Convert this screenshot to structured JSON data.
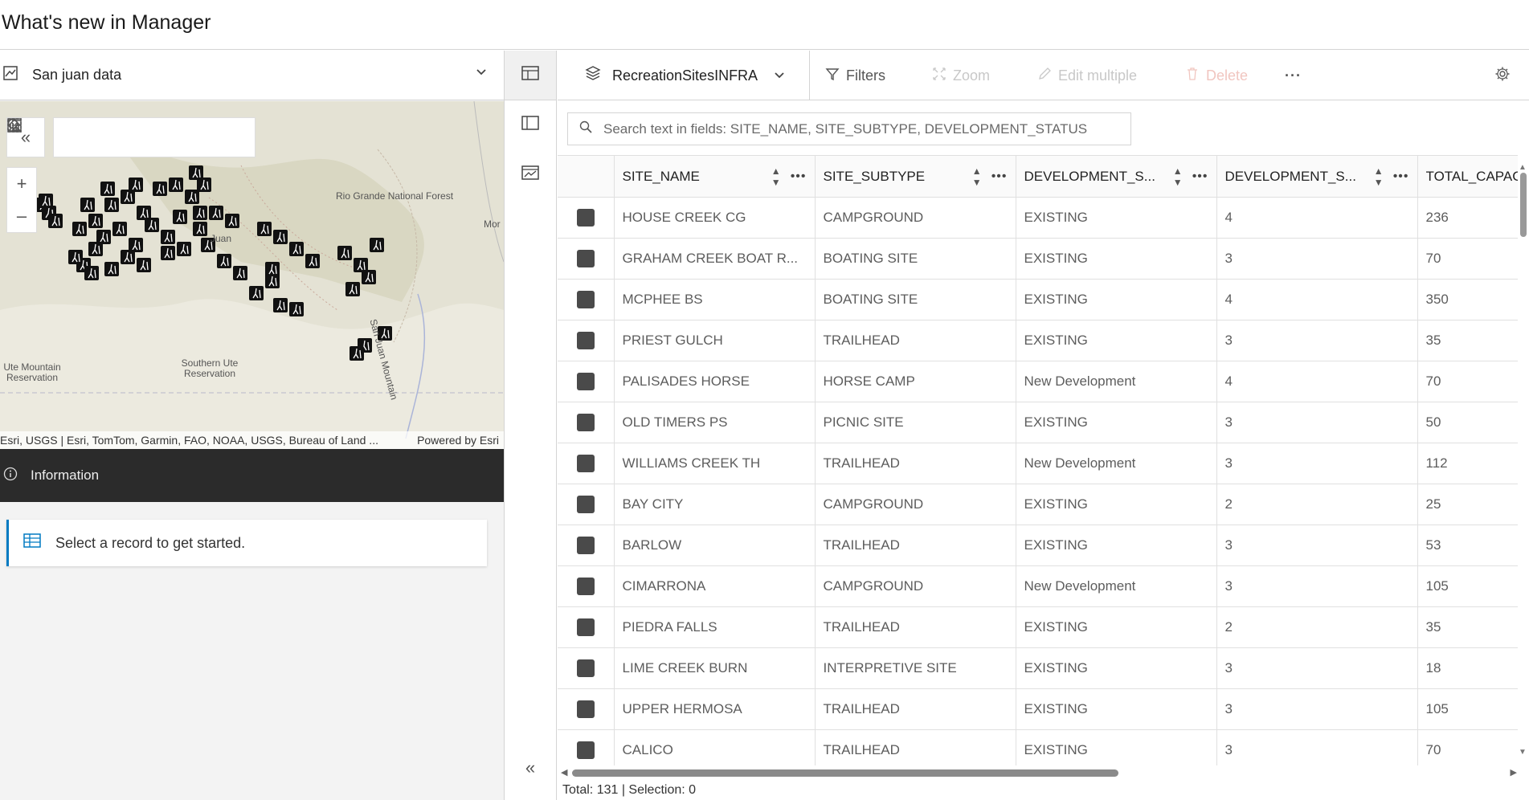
{
  "app": {
    "title": "What's new in Manager"
  },
  "map_selector": {
    "label": "San juan data",
    "icon": "map-icon",
    "chevron": "chevron-down-icon"
  },
  "map": {
    "toolbar": {
      "collapse": "«",
      "tools": [
        "home-icon",
        "list-icon",
        "search-icon",
        "extent-icon",
        "select-icon"
      ]
    },
    "zoom": {
      "in": "+",
      "out": "–"
    },
    "labels": {
      "rio_grande": "Rio Grande National Forest",
      "ute_mountain": "Ute Mountain Reservation",
      "southern_ute": "Southern Ute Reservation",
      "san_juan": "San Juan Mountain",
      "mor": "Mor",
      "juan": "Juan"
    },
    "attribution": "Esri, USGS | Esri, TomTom, Garmin, FAO, NOAA, USGS, Bureau of Land ...",
    "powered_by": "Powered by Esri"
  },
  "info_panel": {
    "title": "Information",
    "message": "Select a record to get started."
  },
  "toolbar": {
    "layer": "RecreationSitesINFRA",
    "filters": "Filters",
    "zoom": "Zoom",
    "edit_multiple": "Edit multiple",
    "delete": "Delete",
    "more": "···"
  },
  "search": {
    "placeholder": "Search text in fields: SITE_NAME, SITE_SUBTYPE, DEVELOPMENT_STATUS"
  },
  "table": {
    "columns": [
      "SITE_NAME",
      "SITE_SUBTYPE",
      "DEVELOPMENT_S...",
      "DEVELOPMENT_S...",
      "TOTAL_CAPAC"
    ],
    "rows": [
      [
        "HOUSE CREEK CG",
        "CAMPGROUND",
        "EXISTING",
        "4",
        "236"
      ],
      [
        "GRAHAM CREEK BOAT R...",
        "BOATING SITE",
        "EXISTING",
        "3",
        "70"
      ],
      [
        "MCPHEE BS",
        "BOATING SITE",
        "EXISTING",
        "4",
        "350"
      ],
      [
        "PRIEST GULCH",
        "TRAILHEAD",
        "EXISTING",
        "3",
        "35"
      ],
      [
        "PALISADES HORSE",
        "HORSE CAMP",
        "New Development",
        "4",
        "70"
      ],
      [
        "OLD TIMERS PS",
        "PICNIC SITE",
        "EXISTING",
        "3",
        "50"
      ],
      [
        "WILLIAMS CREEK TH",
        "TRAILHEAD",
        "New Development",
        "3",
        "112"
      ],
      [
        "BAY CITY",
        "CAMPGROUND",
        "EXISTING",
        "2",
        "25"
      ],
      [
        "BARLOW",
        "TRAILHEAD",
        "EXISTING",
        "3",
        "53"
      ],
      [
        "CIMARRONA",
        "CAMPGROUND",
        "New Development",
        "3",
        "105"
      ],
      [
        "PIEDRA FALLS",
        "TRAILHEAD",
        "EXISTING",
        "2",
        "35"
      ],
      [
        "LIME CREEK BURN",
        "INTERPRETIVE SITE",
        "EXISTING",
        "3",
        "18"
      ],
      [
        "UPPER HERMOSA",
        "TRAILHEAD",
        "EXISTING",
        "3",
        "105"
      ],
      [
        "CALICO",
        "TRAILHEAD",
        "EXISTING",
        "3",
        "70"
      ]
    ]
  },
  "footer": {
    "status": "Total: 131 | Selection: 0"
  },
  "rail": {
    "collapse": "«"
  }
}
